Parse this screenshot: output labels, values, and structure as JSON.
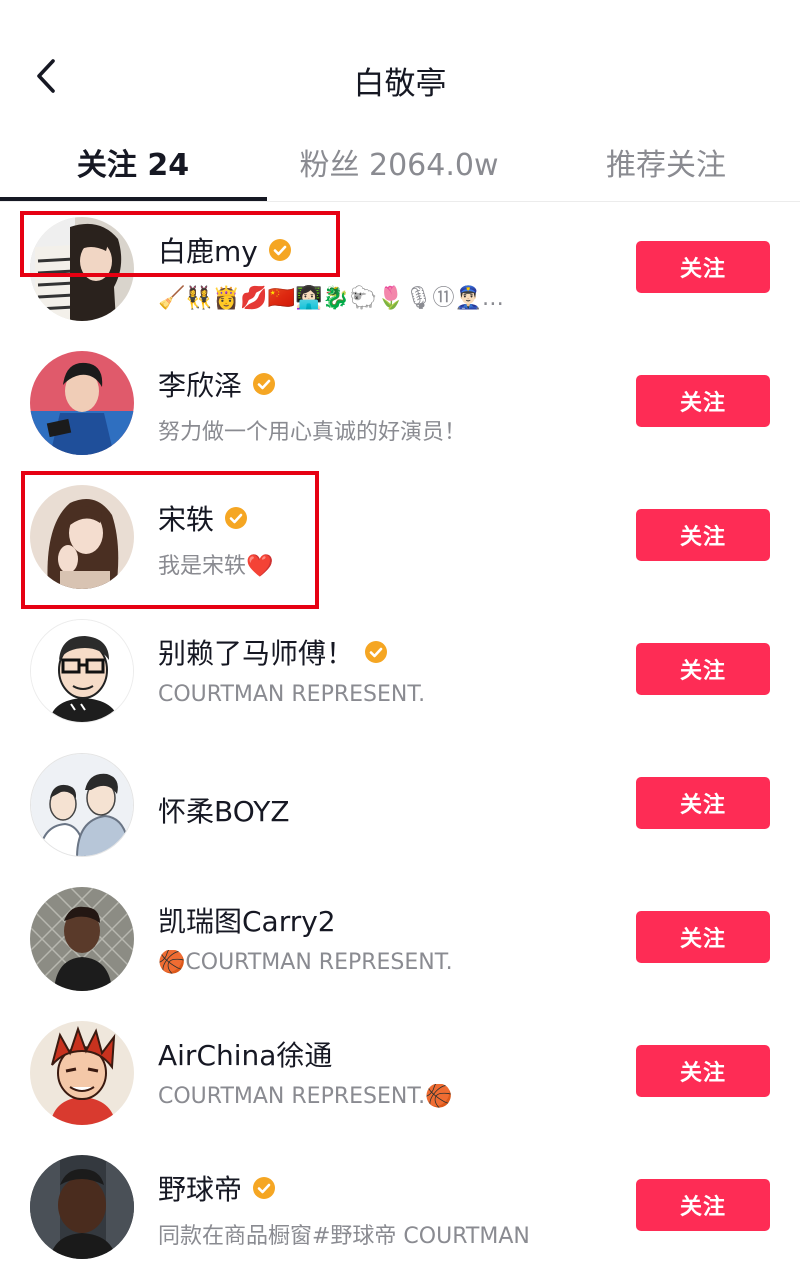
{
  "header": {
    "title": "白敬亭",
    "back_icon": "chevron-left-icon"
  },
  "tabs": [
    {
      "label": "关注 24",
      "active": true
    },
    {
      "label": "粉丝 2064.0w",
      "active": false
    },
    {
      "label": "推荐关注",
      "active": false
    }
  ],
  "colors": {
    "accent": "#fe2c55",
    "verified": "#f5a623",
    "annotation": "#e60012",
    "text_primary": "#161823",
    "text_secondary": "#8a8b91"
  },
  "users": [
    {
      "name": "白鹿my",
      "verified": true,
      "bio": "🧹👯‍♀️👸💋🇨🇳👩🏻‍💻🐉🐑🌷🎙⑪👮🏻‍♂️…",
      "button": "关注",
      "highlighted": true
    },
    {
      "name": "李欣泽",
      "verified": true,
      "bio": "努力做一个用心真诚的好演员！",
      "button": "关注",
      "highlighted": false
    },
    {
      "name": "宋轶",
      "verified": true,
      "bio": "我是宋轶❤️",
      "button": "关注",
      "highlighted": true
    },
    {
      "name": "别赖了马师傅！",
      "verified": true,
      "bio": "COURTMAN REPRESENT.",
      "button": "关注",
      "highlighted": false
    },
    {
      "name": "怀柔BOYZ",
      "verified": false,
      "bio": "",
      "button": "关注",
      "highlighted": false
    },
    {
      "name": "凯瑞图Carry2",
      "verified": false,
      "bio": "🏀COURTMAN REPRESENT.",
      "button": "关注",
      "highlighted": false
    },
    {
      "name": "AirChina徐通",
      "verified": false,
      "bio": "COURTMAN REPRESENT.🏀",
      "button": "关注",
      "highlighted": false
    },
    {
      "name": "野球帝",
      "verified": true,
      "bio": "同款在商品橱窗#野球帝 COURTMAN",
      "button": "关注",
      "highlighted": false
    }
  ]
}
